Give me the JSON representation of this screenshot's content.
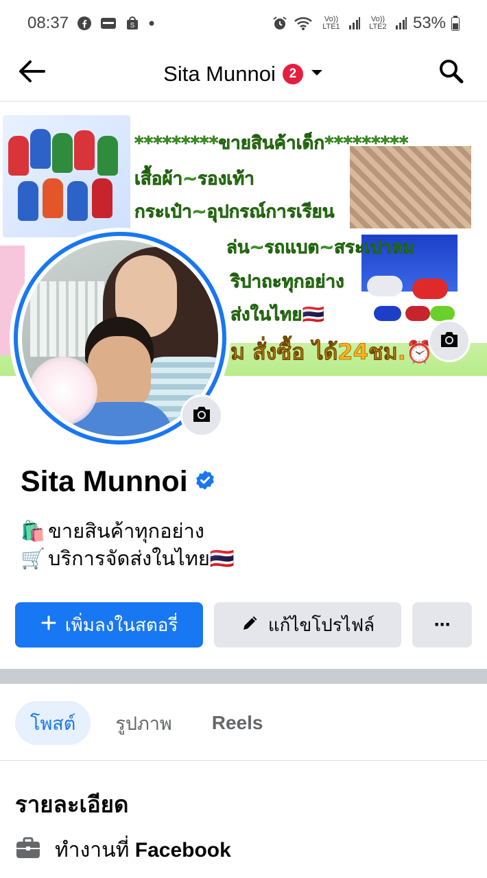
{
  "status_bar": {
    "time": "08:37",
    "battery": "53%",
    "sim1": "Vo)) LTE1",
    "sim2": "Vo)) LTE2",
    "app_icons": [
      "facebook-icon",
      "card-icon",
      "shop-icon"
    ]
  },
  "header": {
    "title": "Sita Munnoi",
    "badge_count": "2"
  },
  "cover": {
    "lines": [
      "*********ขายสินค้าเด็ก*********",
      "เสื้อผ้า~รองเท้า",
      "กระเป๋า~อุปกรณ์การเรียน",
      "ล่น~รถแบต~สระเปาลม",
      "ริปาถะทุกอย่าง",
      "ส่งในไทย🇹🇭",
      "ม สั่งซื้อ ได้24ชม.⏰"
    ]
  },
  "profile": {
    "name": "Sita Munnoi",
    "bio_lines": [
      {
        "emoji": "🛍️",
        "text": "ขายสินค้าทุกอย่าง"
      },
      {
        "emoji": "🛒",
        "text": "บริการจัดส่งในไทย🇹🇭"
      }
    ]
  },
  "actions": {
    "add_story": "เพิ่มลงในสตอรี่",
    "edit_profile": "แก้ไขโปรไฟล์",
    "more": "···"
  },
  "tabs": [
    {
      "label": "โพสต์",
      "active": true
    },
    {
      "label": "รูปภาพ",
      "active": false
    },
    {
      "label": "Reels",
      "active": false
    }
  ],
  "details": {
    "title": "รายละเอียด",
    "work_prefix": "ทำงานที่",
    "work_company": "Facebook"
  },
  "colors": {
    "accent": "#1877f2",
    "badge": "#e41e3f",
    "button_secondary": "#e4e6eb",
    "tab_active_bg": "#e7f0fd"
  }
}
